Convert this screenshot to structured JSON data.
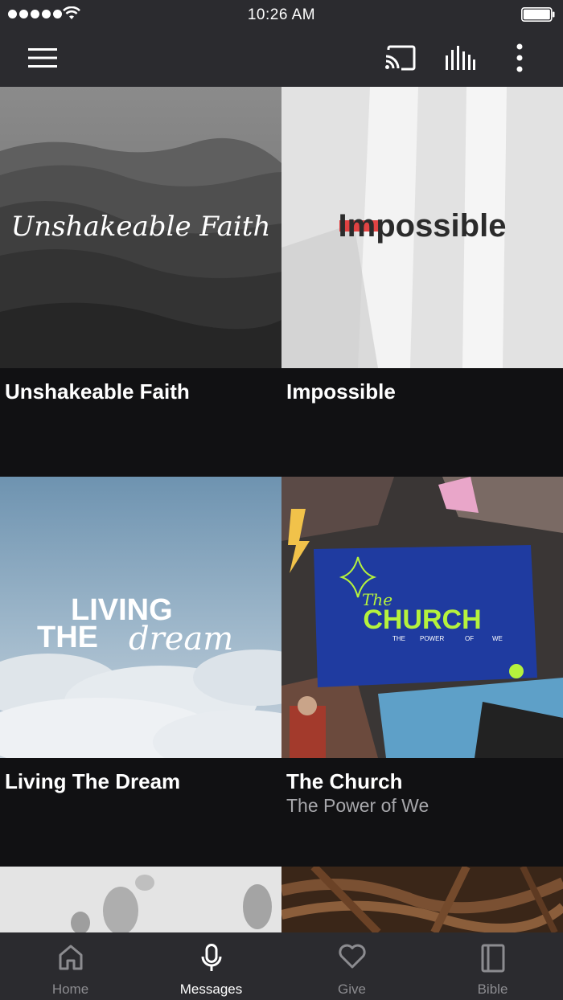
{
  "status_bar": {
    "time": "10:26 AM"
  },
  "app_bar": {
    "icons": [
      "menu-icon",
      "cast-icon",
      "equalizer-icon",
      "more-vertical-icon"
    ]
  },
  "series": [
    {
      "title": "Unshakeable Faith",
      "subtitle": "",
      "artwork_text": "Unshakeable Faith"
    },
    {
      "title": "Impossible",
      "subtitle": "",
      "artwork_text": "Impossible"
    },
    {
      "title": "Living The Dream",
      "subtitle": "",
      "artwork_text_line1": "LIVING",
      "artwork_text_line2": "THE",
      "artwork_text_script": "dream"
    },
    {
      "title": "The Church",
      "subtitle": "The Power of We",
      "artwork_text_script": "The",
      "artwork_text_main": "CHURCH",
      "artwork_text_small": [
        "THE",
        "POWER",
        "OF",
        "WE"
      ]
    }
  ],
  "tabs": [
    {
      "label": "Home",
      "icon": "home-icon",
      "active": false
    },
    {
      "label": "Messages",
      "icon": "microphone-icon",
      "active": true
    },
    {
      "label": "Give",
      "icon": "heart-icon",
      "active": false
    },
    {
      "label": "Bible",
      "icon": "book-icon",
      "active": false
    }
  ],
  "colors": {
    "bar_background": "#2b2b2f",
    "page_background": "#111113",
    "tab_inactive": "#8c8c90",
    "tab_active": "#ffffff",
    "subtitle": "#a7a7ab",
    "church_green": "#b5f23d",
    "church_blue": "#1f3ba0",
    "impossible_red": "#e03131"
  }
}
